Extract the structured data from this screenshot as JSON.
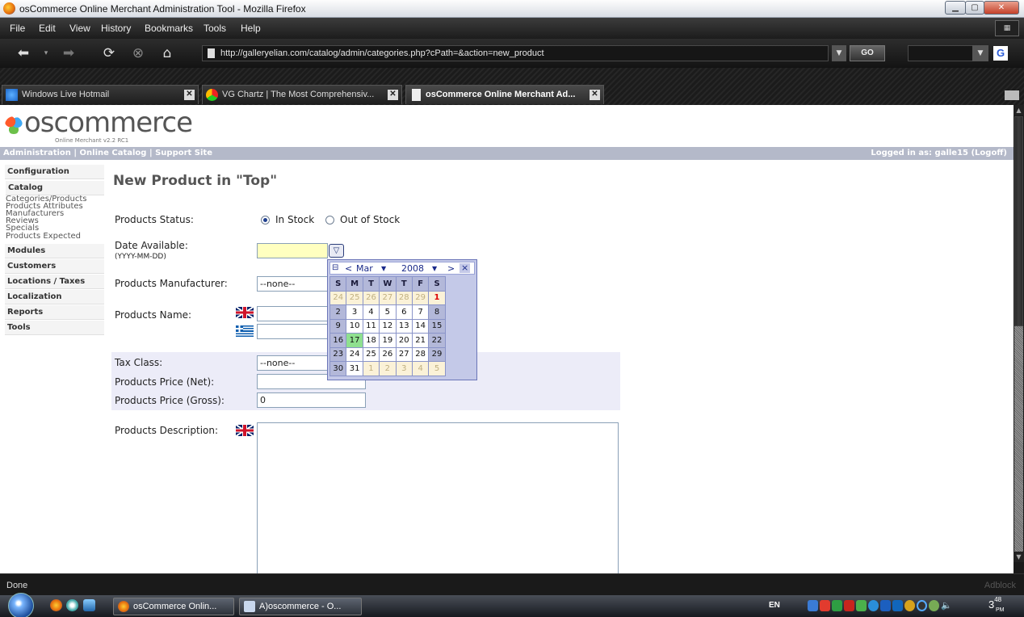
{
  "window": {
    "title": "osCommerce Online Merchant Administration Tool - Mozilla Firefox"
  },
  "menubar": {
    "items": [
      "File",
      "Edit",
      "View",
      "History",
      "Bookmarks",
      "Tools",
      "Help"
    ]
  },
  "navbar": {
    "url": "http://galleryelian.com/catalog/admin/categories.php?cPath=&action=new_product",
    "go_label": "GO",
    "search_engine_icon": "G"
  },
  "tabs": [
    {
      "label": "Windows Live Hotmail",
      "active": false
    },
    {
      "label": "VG Chartz | The Most Comprehensiv...",
      "active": false
    },
    {
      "label": "osCommerce Online Merchant Ad...",
      "active": true
    }
  ],
  "logo": {
    "word": "oscommerce",
    "version": "Online Merchant v2.2 RC1"
  },
  "header": {
    "links": [
      "Administration",
      "Online Catalog",
      "Support Site"
    ],
    "sep": "|",
    "logged_in": "Logged in as: galle15 (Logoff)"
  },
  "sidebar": {
    "configuration": "Configuration",
    "catalog": "Catalog",
    "catalog_items": [
      "Categories/Products",
      "Products Attributes",
      "Manufacturers",
      "Reviews",
      "Specials",
      "Products Expected"
    ],
    "modules": "Modules",
    "customers": "Customers",
    "locations": "Locations / Taxes",
    "localization": "Localization",
    "reports": "Reports",
    "tools": "Tools"
  },
  "form": {
    "title": "New Product in \"Top\"",
    "status_label": "Products Status:",
    "in_stock": "In Stock",
    "out_of_stock": "Out of Stock",
    "date_label": "Date Available:",
    "date_format": "(YYYY-MM-DD)",
    "date_value": "",
    "manufacturer_label": "Products Manufacturer:",
    "manufacturer_value": "--none--",
    "name_label": "Products Name:",
    "tax_label": "Tax Class:",
    "tax_value": "--none--",
    "price_net_label": "Products Price (Net):",
    "price_net_value": "",
    "price_gross_label": "Products Price (Gross):",
    "price_gross_value": "0",
    "desc_label": "Products Description:"
  },
  "calendar": {
    "month": "Mar",
    "year": "2008",
    "prev": "<",
    "next": ">",
    "close": "×",
    "dow": [
      "S",
      "M",
      "T",
      "W",
      "T",
      "F",
      "S"
    ],
    "weeks": [
      [
        "24",
        "25",
        "26",
        "27",
        "28",
        "29",
        "1"
      ],
      [
        "2",
        "3",
        "4",
        "5",
        "6",
        "7",
        "8"
      ],
      [
        "9",
        "10",
        "11",
        "12",
        "13",
        "14",
        "15"
      ],
      [
        "16",
        "17",
        "18",
        "19",
        "20",
        "21",
        "22"
      ],
      [
        "23",
        "24",
        "25",
        "26",
        "27",
        "28",
        "29"
      ],
      [
        "30",
        "31",
        "1",
        "2",
        "3",
        "4",
        "5"
      ]
    ]
  },
  "statusbar": {
    "text": "Done",
    "adblock": "Adblock"
  },
  "taskbar": {
    "buttons": [
      "osCommerce Onlin...",
      "A)oscommerce - O..."
    ],
    "lang": "EN",
    "time_hour": "3",
    "time_min": "48",
    "time_ampm": "PM"
  }
}
